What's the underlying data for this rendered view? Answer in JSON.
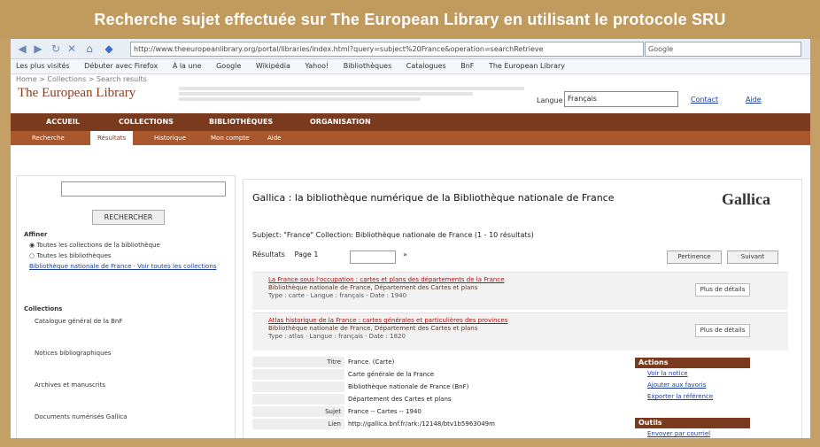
{
  "caption": "Recherche sujet effectuée sur The European Library en utilisant le protocole SRU",
  "browser": {
    "url": "http://www.theeuropeanlibrary.org/portal/libraries/index.html?query=subject%20France&operation=searchRetrieve",
    "search_placeholder": "Google",
    "bookmarks": [
      "Les plus visités",
      "Débuter avec Firefox",
      "À la une",
      "Google",
      "Wikipédia",
      "Yahoo!",
      "Bibliothèques",
      "Catalogues",
      "BnF",
      "The European Library"
    ]
  },
  "site": {
    "breadcrumb": "Home > Collections > Search results",
    "logo": "The European Library",
    "language_label": "Langue",
    "language_value": "Français",
    "header_links": [
      "Contact",
      "Aide"
    ],
    "main_nav": [
      "ACCUEIL",
      "COLLECTIONS",
      "BIBLIOTHÈQUES",
      "ORGANISATION"
    ],
    "sub_nav": [
      "Recherche",
      "Résultats",
      "Historique",
      "Mon compte",
      "Aide"
    ]
  },
  "sidebar": {
    "search_button": "RECHERCHER",
    "filters_title": "Affiner",
    "option_1": "Toutes les collections de la bibliothèque",
    "option_2": "Toutes les bibliothèques",
    "links": "Bibliothèque nationale de France · Voir toutes les collections",
    "facets_title": "Collections",
    "facet_1": "Catalogue général de la BnF",
    "facet_2": "Notices bibliographiques",
    "facet_3": "Archives et manuscrits",
    "facet_4": "Documents numérisés Gallica"
  },
  "results": {
    "title": "Gallica : la bibliothèque numérique de la Bibliothèque nationale de France",
    "logo": "Gallica",
    "query": "Subject: \"France\" Collection: Bibliothèque nationale de France (1 - 10 résultats)",
    "toolbar_label": "Résultats",
    "toolbar_page": "Page 1",
    "sort_label": "Pertinence",
    "next_label": "Suivant",
    "records": [
      {
        "title": "La France sous l'occupation : cartes et plans des départements de la France",
        "detail": "Bibliothèque nationale de France, Département des Cartes et plans",
        "meta": "Type : carte · Langue : français · Date : 1940",
        "action": "Plus de détails"
      },
      {
        "title": "Atlas historique de la France : cartes générales et particulières des provinces",
        "detail": "Bibliothèque nationale de France, Département des Cartes et plans",
        "meta": "Type : atlas · Langue : français · Date : 1820",
        "action": "Plus de détails"
      }
    ],
    "details": [
      {
        "label": "Titre",
        "value": "France. (Carte)"
      },
      {
        "label": "",
        "value": "Carte générale de la France"
      },
      {
        "label": "",
        "value": "Bibliothèque nationale de France (BnF)"
      },
      {
        "label": "",
        "value": "Département des Cartes et plans"
      },
      {
        "label": "Sujet",
        "value": "France -- Cartes -- 1940"
      },
      {
        "label": "Lien",
        "value": "http://gallica.bnf.fr/ark:/12148/btv1b5963049m"
      }
    ],
    "panel_1_title": "Actions",
    "panel_1_items": [
      "Voir la notice",
      "Ajouter aux favoris",
      "Exporter la référence"
    ],
    "panel_2_title": "Outils",
    "panel_2_items": [
      "Envoyer par courriel"
    ]
  }
}
